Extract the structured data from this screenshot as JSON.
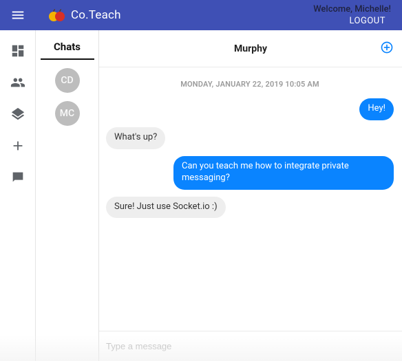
{
  "topbar": {
    "brand": "Co.Teach",
    "welcome": "Welcome, Michelle!",
    "logout": "LOGOUT"
  },
  "sidebar": {
    "items": [
      {
        "name": "dashboard"
      },
      {
        "name": "people"
      },
      {
        "name": "layers"
      },
      {
        "name": "add"
      },
      {
        "name": "chat"
      }
    ]
  },
  "chats": {
    "header": "Chats",
    "list": [
      {
        "initials": "CD"
      },
      {
        "initials": "MC"
      }
    ]
  },
  "conversation": {
    "title": "Murphy",
    "dateSeparator": "MONDAY, JANUARY 22, 2019 10:05 AM",
    "messages": [
      {
        "from": "me",
        "text": "Hey!"
      },
      {
        "from": "them",
        "text": "What's up?"
      },
      {
        "from": "me",
        "text": "Can you teach me how to integrate private messaging?"
      },
      {
        "from": "them",
        "text": "Sure! Just use Socket.io :)"
      }
    ],
    "composerPlaceholder": "Type a message"
  }
}
